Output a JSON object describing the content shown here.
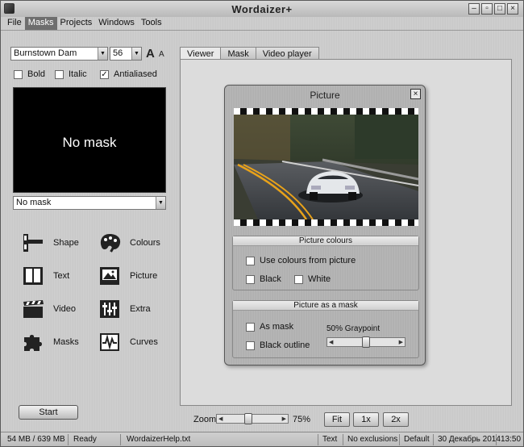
{
  "window": {
    "title": "Wordaizer+"
  },
  "menu": [
    "File",
    "Masks",
    "Projects",
    "Windows",
    "Tools"
  ],
  "font": {
    "family": "Burnstown Dam",
    "size": "56",
    "bold": "Bold",
    "italic": "Italic",
    "antialiased": "Antialiased"
  },
  "preview": {
    "text": "No mask",
    "selected": "No mask"
  },
  "tools": [
    {
      "label": "Shape",
      "icon": "shape-icon"
    },
    {
      "label": "Colours",
      "icon": "palette-icon"
    },
    {
      "label": "Text",
      "icon": "book-icon"
    },
    {
      "label": "Picture",
      "icon": "picture-icon"
    },
    {
      "label": "Video",
      "icon": "clapper-icon"
    },
    {
      "label": "Extra",
      "icon": "sliders-icon"
    },
    {
      "label": "Masks",
      "icon": "puzzle-icon"
    },
    {
      "label": "Curves",
      "icon": "curves-icon"
    }
  ],
  "start_label": "Start",
  "tabs": [
    "Viewer",
    "Mask",
    "Video player"
  ],
  "dialog": {
    "title": "Picture",
    "colours_head": "Picture colours",
    "use_colours": "Use colours from picture",
    "black": "Black",
    "white": "White",
    "mask_head": "Picture as a mask",
    "as_mask": "As mask",
    "black_outline": "Black outline",
    "graypoint": "50% Graypoint",
    "graypoint_level": 0.5
  },
  "zoom": {
    "label": "Zoom",
    "value": "75%",
    "level": 0.75,
    "fit": "Fit",
    "x1": "1x",
    "x2": "2x"
  },
  "status": {
    "memory": "54 MB / 639 MB",
    "state": "Ready",
    "file": "WordaizerHelp.txt",
    "mode": "Text",
    "exclusions": "No exclusions",
    "preset": "Default",
    "date": "30 Декабрь 2014",
    "time": "13:50"
  },
  "colors": {
    "menu_active": "#6e6e6e",
    "preview_bg": "#000000",
    "road_line": "#e8a21a"
  }
}
